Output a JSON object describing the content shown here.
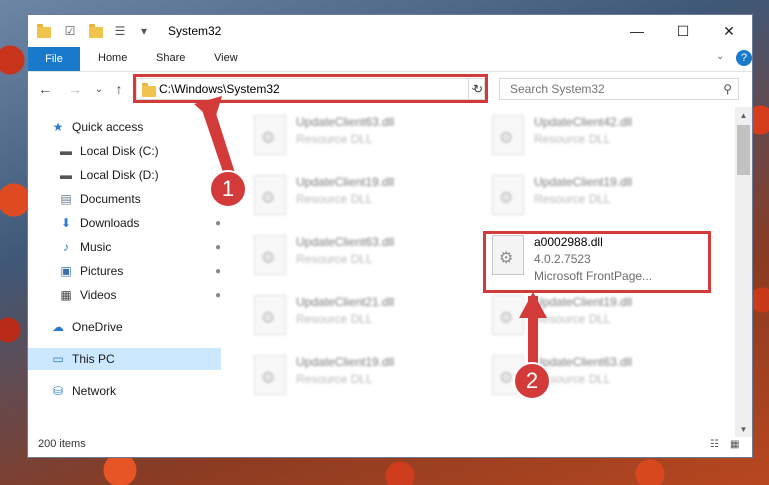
{
  "window": {
    "title": "System32",
    "controls": {
      "minimize": "—",
      "maximize": "☐",
      "close": "✕"
    },
    "help": "?"
  },
  "ribbon": {
    "tabs": [
      "File",
      "Home",
      "Share",
      "View"
    ]
  },
  "nav": {
    "back": "←",
    "forward": "→",
    "recent": "⌄",
    "up": "↑",
    "address": "C:\\Windows\\System32",
    "dropdown": "⌄",
    "refresh": "↻",
    "search_placeholder": "Search System32",
    "search_icon": "⚲"
  },
  "sidebar": {
    "items": [
      {
        "label": "Quick access",
        "icon": "star-icon",
        "glyph": "★",
        "pinned": false
      },
      {
        "label": "Local Disk (C:)",
        "icon": "drive-icon",
        "glyph": "▬",
        "pinned": true
      },
      {
        "label": "Local Disk (D:)",
        "icon": "drive-icon",
        "glyph": "▬",
        "pinned": true
      },
      {
        "label": "Documents",
        "icon": "documents-icon",
        "glyph": "▤",
        "pinned": true
      },
      {
        "label": "Downloads",
        "icon": "download-icon",
        "glyph": "⬇",
        "pinned": true
      },
      {
        "label": "Music",
        "icon": "music-icon",
        "glyph": "♪",
        "pinned": true
      },
      {
        "label": "Pictures",
        "icon": "pictures-icon",
        "glyph": "▣",
        "pinned": true
      },
      {
        "label": "Videos",
        "icon": "videos-icon",
        "glyph": "▦",
        "pinned": true
      },
      {
        "label": "OneDrive",
        "icon": "cloud-icon",
        "glyph": "☁",
        "pinned": false
      },
      {
        "label": "This PC",
        "icon": "computer-icon",
        "glyph": "▭",
        "pinned": false
      },
      {
        "label": "Network",
        "icon": "network-icon",
        "glyph": "⛁",
        "pinned": false
      }
    ],
    "pin_glyph": "📌"
  },
  "files": [
    {
      "name": "UpdateClient63.dll",
      "type": "Resource DLL"
    },
    {
      "name": "UpdateClient42.dll",
      "type": "Resource DLL"
    },
    {
      "name": "UpdateClient19.dll",
      "type": "Resource DLL"
    },
    {
      "name": "UpdateClient19.dll",
      "type": "Resource DLL"
    },
    {
      "name": "UpdateClient63.dll",
      "type": "Resource DLL"
    },
    {
      "name": "UpdateClient21.dll",
      "type": "Resource DLL"
    },
    {
      "name": "UpdateClient19.dll",
      "type": "Resource DLL"
    },
    {
      "name": "UpdateClient19.dll",
      "type": "Resource DLL"
    },
    {
      "name": "UpdateClient63.dll",
      "type": "Resource DLL"
    }
  ],
  "highlight_file": {
    "name": "a0002988.dll",
    "version": "4.0.2.7523",
    "description": "Microsoft FrontPage..."
  },
  "annotations": {
    "marker_1": "1",
    "marker_2": "2",
    "color": "#d33a3a"
  },
  "status": {
    "count": "200 items"
  }
}
